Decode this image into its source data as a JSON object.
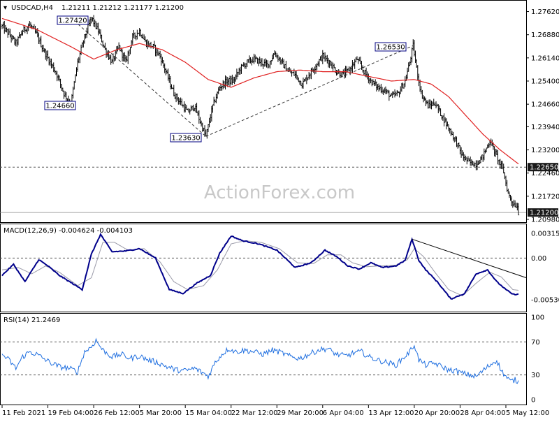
{
  "header": {
    "symbol_tf": "USDCAD,H4",
    "ohlc": "1.21211 1.21212 1.21177 1.21200"
  },
  "watermark": "ActionForex.com",
  "colors": {
    "candles": "#000000",
    "ma": "#e02020",
    "macd": "#00008b",
    "signal": "#9a9aa8",
    "rsi": "#1f6fe0",
    "dashed": "#555555",
    "label_border": "#000080",
    "price_label_bg": "#1a1a1a"
  },
  "chart_data": [
    {
      "type": "candlestick",
      "name": "price",
      "ylim": [
        1.2098,
        1.279
      ],
      "y_ticks": [
        "1.27620",
        "1.26880",
        "1.26140",
        "1.25400",
        "1.24660",
        "1.23940",
        "1.23200",
        "1.22460",
        "1.21720",
        "1.20980"
      ],
      "y_tick_values": [
        1.2762,
        1.2688,
        1.2614,
        1.254,
        1.2466,
        1.2394,
        1.232,
        1.2246,
        1.2172,
        1.2098
      ],
      "x_ticks": [
        "11 Feb 2021",
        "19 Feb 04:00",
        "26 Feb 12:00",
        "5 Mar 20:00",
        "15 Mar 04:00",
        "22 Mar 12:00",
        "29 Mar 20:00",
        "6 Apr 04:00",
        "13 Apr 12:00",
        "20 Apr 20:00",
        "28 Apr 04:00",
        "5 May 12:00"
      ],
      "x_tick_index": [
        0,
        40,
        80,
        120,
        160,
        200,
        240,
        280,
        320,
        360,
        400,
        440
      ],
      "bar_count": 452,
      "close_anchors": [
        [
          0,
          1.2715
        ],
        [
          6,
          1.269
        ],
        [
          12,
          1.266
        ],
        [
          18,
          1.27
        ],
        [
          24,
          1.272
        ],
        [
          30,
          1.269
        ],
        [
          36,
          1.264
        ],
        [
          42,
          1.26
        ],
        [
          48,
          1.256
        ],
        [
          54,
          1.25
        ],
        [
          60,
          1.2466
        ],
        [
          66,
          1.26
        ],
        [
          72,
          1.268
        ],
        [
          78,
          1.2742
        ],
        [
          84,
          1.27
        ],
        [
          90,
          1.264
        ],
        [
          96,
          1.26
        ],
        [
          102,
          1.265
        ],
        [
          108,
          1.26
        ],
        [
          114,
          1.268
        ],
        [
          120,
          1.27
        ],
        [
          126,
          1.266
        ],
        [
          132,
          1.265
        ],
        [
          138,
          1.262
        ],
        [
          144,
          1.256
        ],
        [
          150,
          1.25
        ],
        [
          156,
          1.247
        ],
        [
          162,
          1.244
        ],
        [
          168,
          1.246
        ],
        [
          174,
          1.24
        ],
        [
          178,
          1.2363
        ],
        [
          184,
          1.246
        ],
        [
          190,
          1.252
        ],
        [
          196,
          1.254
        ],
        [
          202,
          1.254
        ],
        [
          208,
          1.258
        ],
        [
          214,
          1.26
        ],
        [
          220,
          1.261
        ],
        [
          226,
          1.26
        ],
        [
          232,
          1.259
        ],
        [
          238,
          1.263
        ],
        [
          244,
          1.26
        ],
        [
          250,
          1.257
        ],
        [
          256,
          1.256
        ],
        [
          262,
          1.253
        ],
        [
          268,
          1.256
        ],
        [
          274,
          1.259
        ],
        [
          280,
          1.262
        ],
        [
          286,
          1.26
        ],
        [
          292,
          1.257
        ],
        [
          298,
          1.256
        ],
        [
          304,
          1.258
        ],
        [
          310,
          1.261
        ],
        [
          316,
          1.257
        ],
        [
          322,
          1.254
        ],
        [
          328,
          1.252
        ],
        [
          334,
          1.251
        ],
        [
          340,
          1.249
        ],
        [
          346,
          1.25
        ],
        [
          352,
          1.254
        ],
        [
          356,
          1.26
        ],
        [
          359,
          1.2653
        ],
        [
          362,
          1.258
        ],
        [
          366,
          1.25
        ],
        [
          372,
          1.246
        ],
        [
          378,
          1.247
        ],
        [
          384,
          1.243
        ],
        [
          390,
          1.239
        ],
        [
          396,
          1.235
        ],
        [
          402,
          1.23
        ],
        [
          408,
          1.228
        ],
        [
          414,
          1.2275
        ],
        [
          420,
          1.23
        ],
        [
          426,
          1.235
        ],
        [
          432,
          1.23
        ],
        [
          438,
          1.225
        ],
        [
          442,
          1.218
        ],
        [
          446,
          1.215
        ],
        [
          450,
          1.214
        ],
        [
          451,
          1.212
        ]
      ],
      "moving_average_anchors": [
        [
          0,
          1.274
        ],
        [
          30,
          1.2705
        ],
        [
          60,
          1.265
        ],
        [
          80,
          1.261
        ],
        [
          100,
          1.264
        ],
        [
          120,
          1.266
        ],
        [
          140,
          1.264
        ],
        [
          160,
          1.26
        ],
        [
          180,
          1.2545
        ],
        [
          200,
          1.252
        ],
        [
          220,
          1.255
        ],
        [
          240,
          1.257
        ],
        [
          260,
          1.2575
        ],
        [
          280,
          1.257
        ],
        [
          300,
          1.257
        ],
        [
          320,
          1.2555
        ],
        [
          340,
          1.254
        ],
        [
          360,
          1.2545
        ],
        [
          375,
          1.253
        ],
        [
          390,
          1.249
        ],
        [
          405,
          1.243
        ],
        [
          420,
          1.237
        ],
        [
          435,
          1.232
        ],
        [
          451,
          1.2275
        ]
      ],
      "trendlines": [
        {
          "from": [
            60,
            1.2742
          ],
          "to": [
            178,
            1.2363
          ]
        },
        {
          "from": [
            178,
            1.2363
          ],
          "to": [
            359,
            1.2653
          ]
        }
      ],
      "level_labels": [
        {
          "text": "1.27420",
          "index": 35,
          "price": 1.2742,
          "side": "left"
        },
        {
          "text": "1.24660",
          "index": 60,
          "price": 1.2466,
          "side": "left"
        },
        {
          "text": "1.23630",
          "index": 178,
          "price": 1.2363,
          "side": "left"
        },
        {
          "text": "1.26530",
          "index": 359,
          "price": 1.2653,
          "side": "left"
        }
      ],
      "hline": {
        "text": "1.22650",
        "price": 1.2265
      },
      "last_price": {
        "text": "1.21200",
        "price": 1.212
      }
    },
    {
      "type": "line",
      "name": "MACD",
      "label": "MACD(12,26,9) -0.004624 -0.004103",
      "ylim": [
        -0.0068,
        0.0042
      ],
      "y_ticks": [
        "0.00315",
        "0.00",
        "-0.005307"
      ],
      "y_tick_values": [
        0.00315,
        0.0,
        -0.005307
      ],
      "zero_line": 0.0,
      "macd_anchors": [
        [
          0,
          -0.0022
        ],
        [
          10,
          -0.0008
        ],
        [
          20,
          -0.003
        ],
        [
          32,
          -0.0002
        ],
        [
          40,
          -0.001
        ],
        [
          50,
          -0.0022
        ],
        [
          70,
          -0.004
        ],
        [
          78,
          0.0005
        ],
        [
          86,
          0.003
        ],
        [
          96,
          0.0008
        ],
        [
          108,
          0.0009
        ],
        [
          120,
          0.0012
        ],
        [
          134,
          0.0
        ],
        [
          146,
          -0.004
        ],
        [
          158,
          -0.0045
        ],
        [
          170,
          -0.0032
        ],
        [
          182,
          -0.0022
        ],
        [
          190,
          0.0006
        ],
        [
          200,
          0.0028
        ],
        [
          210,
          0.0022
        ],
        [
          224,
          0.0018
        ],
        [
          240,
          0.001
        ],
        [
          256,
          -0.0012
        ],
        [
          270,
          -0.0006
        ],
        [
          282,
          0.001
        ],
        [
          292,
          0.0002
        ],
        [
          302,
          -0.001
        ],
        [
          312,
          -0.0014
        ],
        [
          322,
          -0.0006
        ],
        [
          332,
          -0.0012
        ],
        [
          344,
          -0.001
        ],
        [
          352,
          -0.0003
        ],
        [
          358,
          0.0024
        ],
        [
          364,
          -0.0003
        ],
        [
          370,
          -0.0015
        ],
        [
          380,
          -0.003
        ],
        [
          392,
          -0.0052
        ],
        [
          404,
          -0.0045
        ],
        [
          414,
          -0.002
        ],
        [
          424,
          -0.0015
        ],
        [
          432,
          -0.003
        ],
        [
          440,
          -0.004
        ],
        [
          446,
          -0.0046
        ],
        [
          451,
          -0.0046
        ]
      ],
      "signal_anchors": [
        [
          0,
          -0.0015
        ],
        [
          14,
          -0.0012
        ],
        [
          26,
          -0.002
        ],
        [
          38,
          -0.001
        ],
        [
          50,
          -0.0018
        ],
        [
          66,
          -0.0035
        ],
        [
          78,
          -0.0025
        ],
        [
          88,
          0.002
        ],
        [
          98,
          0.002
        ],
        [
          110,
          0.001
        ],
        [
          124,
          0.0012
        ],
        [
          138,
          -0.0005
        ],
        [
          150,
          -0.003
        ],
        [
          162,
          -0.004
        ],
        [
          176,
          -0.0035
        ],
        [
          188,
          -0.0015
        ],
        [
          200,
          0.0018
        ],
        [
          212,
          0.0022
        ],
        [
          226,
          0.002
        ],
        [
          242,
          0.0012
        ],
        [
          258,
          -0.0006
        ],
        [
          272,
          -0.0007
        ],
        [
          284,
          0.0004
        ],
        [
          296,
          0.0004
        ],
        [
          306,
          -0.0006
        ],
        [
          318,
          -0.0011
        ],
        [
          330,
          -0.001
        ],
        [
          344,
          -0.0009
        ],
        [
          354,
          -0.0002
        ],
        [
          360,
          0.0012
        ],
        [
          368,
          0.0002
        ],
        [
          378,
          -0.0018
        ],
        [
          390,
          -0.004
        ],
        [
          402,
          -0.0048
        ],
        [
          414,
          -0.0032
        ],
        [
          426,
          -0.0018
        ],
        [
          436,
          -0.0024
        ],
        [
          446,
          -0.004
        ],
        [
          451,
          -0.0041
        ]
      ],
      "trendline": {
        "from": [
          358,
          0.0024
        ],
        "to": [
          451,
          -0.0025
        ]
      }
    },
    {
      "type": "line",
      "name": "RSI",
      "label": "RSI(14) 21.2469",
      "ylim": [
        0,
        100
      ],
      "y_ticks": [
        "100",
        "70",
        "30",
        "0"
      ],
      "y_tick_values": [
        100,
        70,
        30,
        0
      ],
      "levels": [
        70,
        30
      ],
      "rsi_anchors": [
        [
          0,
          55
        ],
        [
          6,
          48
        ],
        [
          12,
          38
        ],
        [
          18,
          52
        ],
        [
          24,
          58
        ],
        [
          30,
          55
        ],
        [
          36,
          50
        ],
        [
          42,
          45
        ],
        [
          50,
          40
        ],
        [
          58,
          38
        ],
        [
          66,
          34
        ],
        [
          72,
          58
        ],
        [
          78,
          64
        ],
        [
          82,
          72
        ],
        [
          88,
          60
        ],
        [
          96,
          52
        ],
        [
          104,
          55
        ],
        [
          112,
          50
        ],
        [
          120,
          53
        ],
        [
          128,
          48
        ],
        [
          136,
          45
        ],
        [
          144,
          40
        ],
        [
          152,
          36
        ],
        [
          160,
          35
        ],
        [
          168,
          38
        ],
        [
          176,
          32
        ],
        [
          180,
          28
        ],
        [
          186,
          45
        ],
        [
          192,
          55
        ],
        [
          198,
          62
        ],
        [
          204,
          58
        ],
        [
          212,
          60
        ],
        [
          220,
          58
        ],
        [
          228,
          55
        ],
        [
          236,
          60
        ],
        [
          244,
          57
        ],
        [
          252,
          52
        ],
        [
          260,
          50
        ],
        [
          268,
          55
        ],
        [
          276,
          60
        ],
        [
          284,
          62
        ],
        [
          292,
          55
        ],
        [
          300,
          53
        ],
        [
          308,
          57
        ],
        [
          314,
          58
        ],
        [
          320,
          52
        ],
        [
          328,
          48
        ],
        [
          336,
          45
        ],
        [
          344,
          42
        ],
        [
          350,
          50
        ],
        [
          356,
          58
        ],
        [
          360,
          67
        ],
        [
          364,
          48
        ],
        [
          370,
          42
        ],
        [
          378,
          44
        ],
        [
          384,
          40
        ],
        [
          390,
          36
        ],
        [
          396,
          35
        ],
        [
          402,
          32
        ],
        [
          408,
          30
        ],
        [
          414,
          28
        ],
        [
          420,
          35
        ],
        [
          426,
          42
        ],
        [
          432,
          48
        ],
        [
          436,
          35
        ],
        [
          440,
          28
        ],
        [
          444,
          22
        ],
        [
          448,
          24
        ],
        [
          451,
          21.2
        ]
      ]
    }
  ]
}
